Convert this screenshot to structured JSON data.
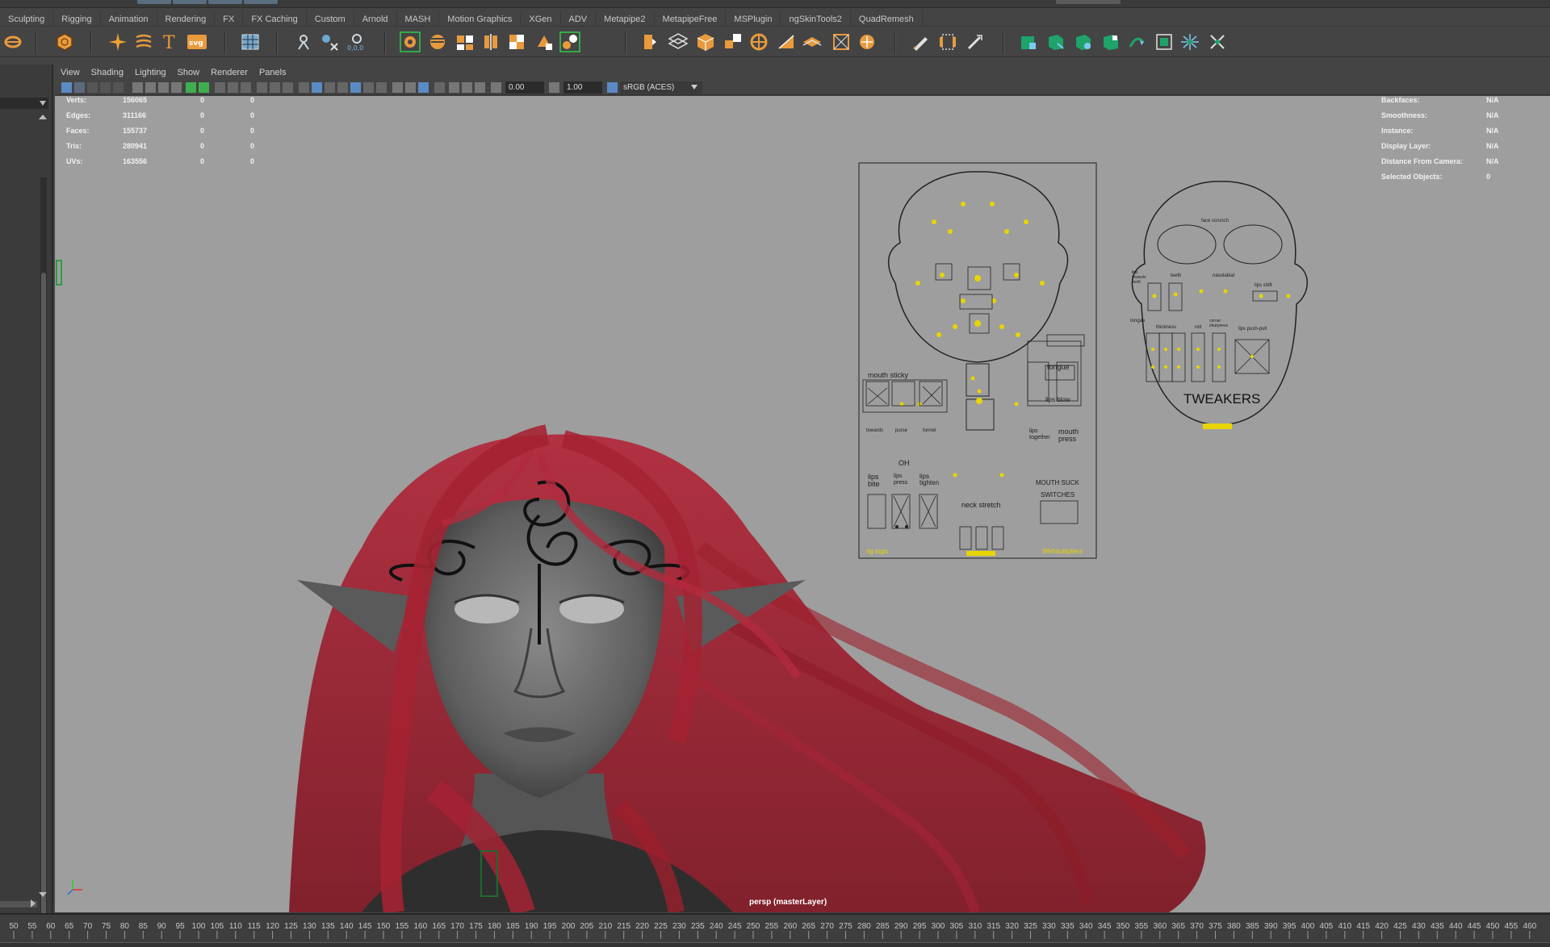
{
  "shelf_tabs": [
    "Sculpting",
    "Rigging",
    "Animation",
    "Rendering",
    "FX",
    "FX Caching",
    "Custom",
    "Arnold",
    "MASH",
    "Motion Graphics",
    "XGen",
    "ADV",
    "Metapipe2",
    "MetapipeFree",
    "MSPlugin",
    "ngSkinTools2",
    "QuadRemesh"
  ],
  "panel_menu": [
    "View",
    "Shading",
    "Lighting",
    "Show",
    "Renderer",
    "Panels"
  ],
  "panel_toolbar": {
    "exposure": "0.00",
    "gamma": "1.00",
    "color_space": "sRGB (ACES)"
  },
  "hud_left": [
    {
      "label": "Verts:",
      "values": [
        "156065",
        "0",
        "0"
      ]
    },
    {
      "label": "Edges:",
      "values": [
        "311166",
        "0",
        "0"
      ]
    },
    {
      "label": "Faces:",
      "values": [
        "155737",
        "0",
        "0"
      ]
    },
    {
      "label": "Tris:",
      "values": [
        "280941",
        "0",
        "0"
      ]
    },
    {
      "label": "UVs:",
      "values": [
        "163556",
        "0",
        "0"
      ]
    }
  ],
  "hud_right": [
    {
      "label": "Backfaces:",
      "value": "N/A"
    },
    {
      "label": "Smoothness:",
      "value": "N/A"
    },
    {
      "label": "Instance:",
      "value": "N/A"
    },
    {
      "label": "Display Layer:",
      "value": "N/A"
    },
    {
      "label": "Distance From Camera:",
      "value": "N/A"
    },
    {
      "label": "Selected Objects:",
      "value": "0"
    }
  ],
  "camera_label": "persp (masterLayer)",
  "face_panel_main": {
    "mouth_sticky": "mouth sticky",
    "tongue": "tongue",
    "lips_blow": "lips blow",
    "towards": "towards",
    "purse": "purse",
    "funnel": "funnel",
    "oh": "OH",
    "lips_together": "lips together",
    "mouth_press": "mouth press",
    "lips_bite": "lips bite",
    "lips_press": "lips press",
    "lips_tighten": "lips tighten",
    "mouth_suck": "MOUTH SUCK",
    "neck_stretch": "neck stretch",
    "switches": "SWITCHES",
    "rig_logic": "rig logic",
    "wm_multipliers": "WMmultipliers"
  },
  "face_panel_tweakers": {
    "face_scrunch": "face scrunch",
    "lips_towards_teeth": "lips towards teeth",
    "teeth": "teeth",
    "nasolabial": "nasolabial",
    "lips_shift": "lips shift",
    "tongue": "tongue",
    "thickness": "thickness",
    "roll": "roll",
    "corner_sharpness": "corner sharpness",
    "lips_push_pull": "lips push-pull",
    "title": "TWEAKERS"
  },
  "timeline_start": 50,
  "timeline_step": 5,
  "colors": {
    "hair": "#9c1f2c",
    "viewport_bg": "#9e9e9e",
    "controller_yellow": "#e8d400"
  }
}
